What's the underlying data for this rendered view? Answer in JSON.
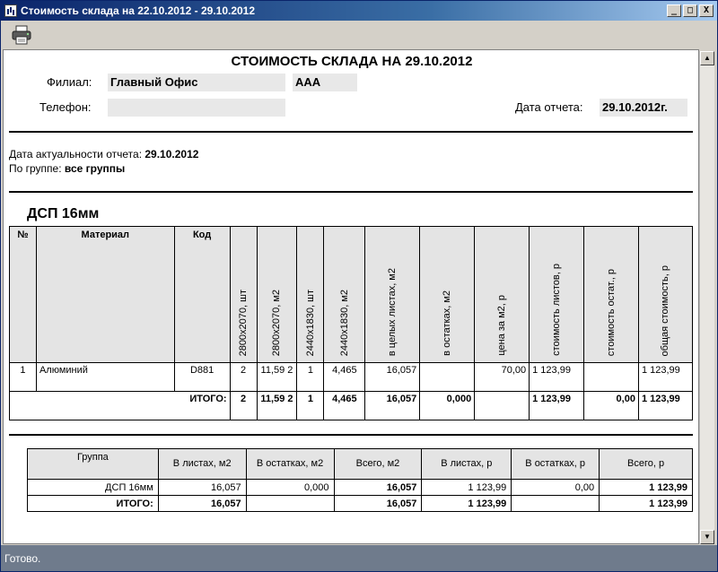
{
  "window": {
    "title": "Стоимость склада на 22.10.2012 - 29.10.2012",
    "minimize": "_",
    "maximize": "□",
    "close": "X"
  },
  "toolbar": {
    "print_icon": "printer-icon"
  },
  "report": {
    "title": "СТОИМОСТЬ СКЛАДА НА 29.10.2012",
    "branch_label": "Филиал:",
    "branch_value": "Главный Офис",
    "branch_code": "AAA",
    "phone_label": "Телефон:",
    "phone_value": "",
    "report_date_label": "Дата отчета:",
    "report_date_value": "29.10.2012г.",
    "actuality_label": "Дата актуальности отчета:",
    "actuality_value": "29.10.2012",
    "group_label": "По группе:",
    "group_value": "все группы",
    "section_title": "ДСП 16мм"
  },
  "materials_table": {
    "headers": {
      "num": "№",
      "material": "Материал",
      "code": "Код",
      "c1": "2800x2070, шт",
      "c2": "2800x2070, м2",
      "c3": "2440x1830, шт",
      "c4": "2440x1830, м2",
      "c5": "в целых листах, м2",
      "c6": "в остатках, м2",
      "c7": "цена за м2,   р",
      "c8": "стоимость листов,   р",
      "c9": "стоимость остат.,   р",
      "c10": "общая стоимость,   р"
    },
    "row": {
      "num": "1",
      "material": "Алюминий",
      "code": "D881",
      "c1": "2",
      "c2": "11,59 2",
      "c3": "1",
      "c4": "4,465",
      "c5": "16,057",
      "c6": "",
      "c7": "70,00",
      "c8": "1 123,99",
      "c9": "",
      "c10": "1 123,99"
    },
    "total": {
      "label": "ИТОГО:",
      "c1": "2",
      "c2": "11,59 2",
      "c3": "1",
      "c4": "4,465",
      "c5": "16,057",
      "c6": "0,000",
      "c7": "",
      "c8": "1 123,99",
      "c9": "0,00",
      "c10": "1 123,99"
    }
  },
  "summary_table": {
    "headers": [
      "Группа",
      "В листах, м2",
      "В остатках, м2",
      "Всего, м2",
      "В листах, р",
      "В остатках, р",
      "Всего, р"
    ],
    "row": [
      "ДСП 16мм",
      "16,057",
      "0,000",
      "16,057",
      "1 123,99",
      "0,00",
      "1 123,99"
    ],
    "total": [
      "ИТОГО:",
      "16,057",
      "",
      "16,057",
      "1 123,99",
      "",
      "1 123,99"
    ]
  },
  "status": {
    "text": "Готово."
  }
}
